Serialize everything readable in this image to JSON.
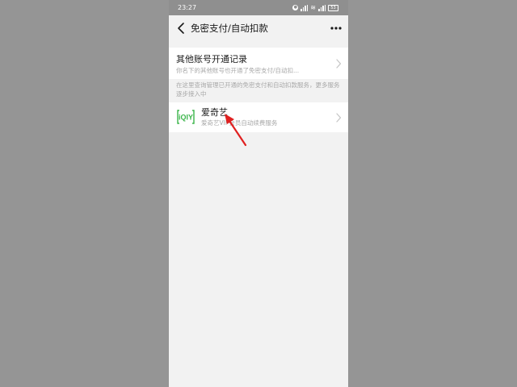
{
  "status_bar": {
    "time": "23:27",
    "battery": "53"
  },
  "nav": {
    "title": "免密支付/自动扣款"
  },
  "other_accounts": {
    "title": "其他账号开通记录",
    "subtitle": "你名下的其他账号也开通了免密支付/自动扣..."
  },
  "notice": "在这里查询管理已开通的免密支付和自动扣款服务，更多服务逐步接入中",
  "services": [
    {
      "name": "爱奇艺",
      "logo_text": "iQIY",
      "description": "爱奇艺VIP会员自动续费服务"
    }
  ],
  "colors": {
    "accent_green": "#3bb54a",
    "annotation_red": "#e02020"
  },
  "icons": {
    "back": "back-arrow-icon",
    "more": "more-dots-icon",
    "chevron": "chevron-right-icon"
  }
}
